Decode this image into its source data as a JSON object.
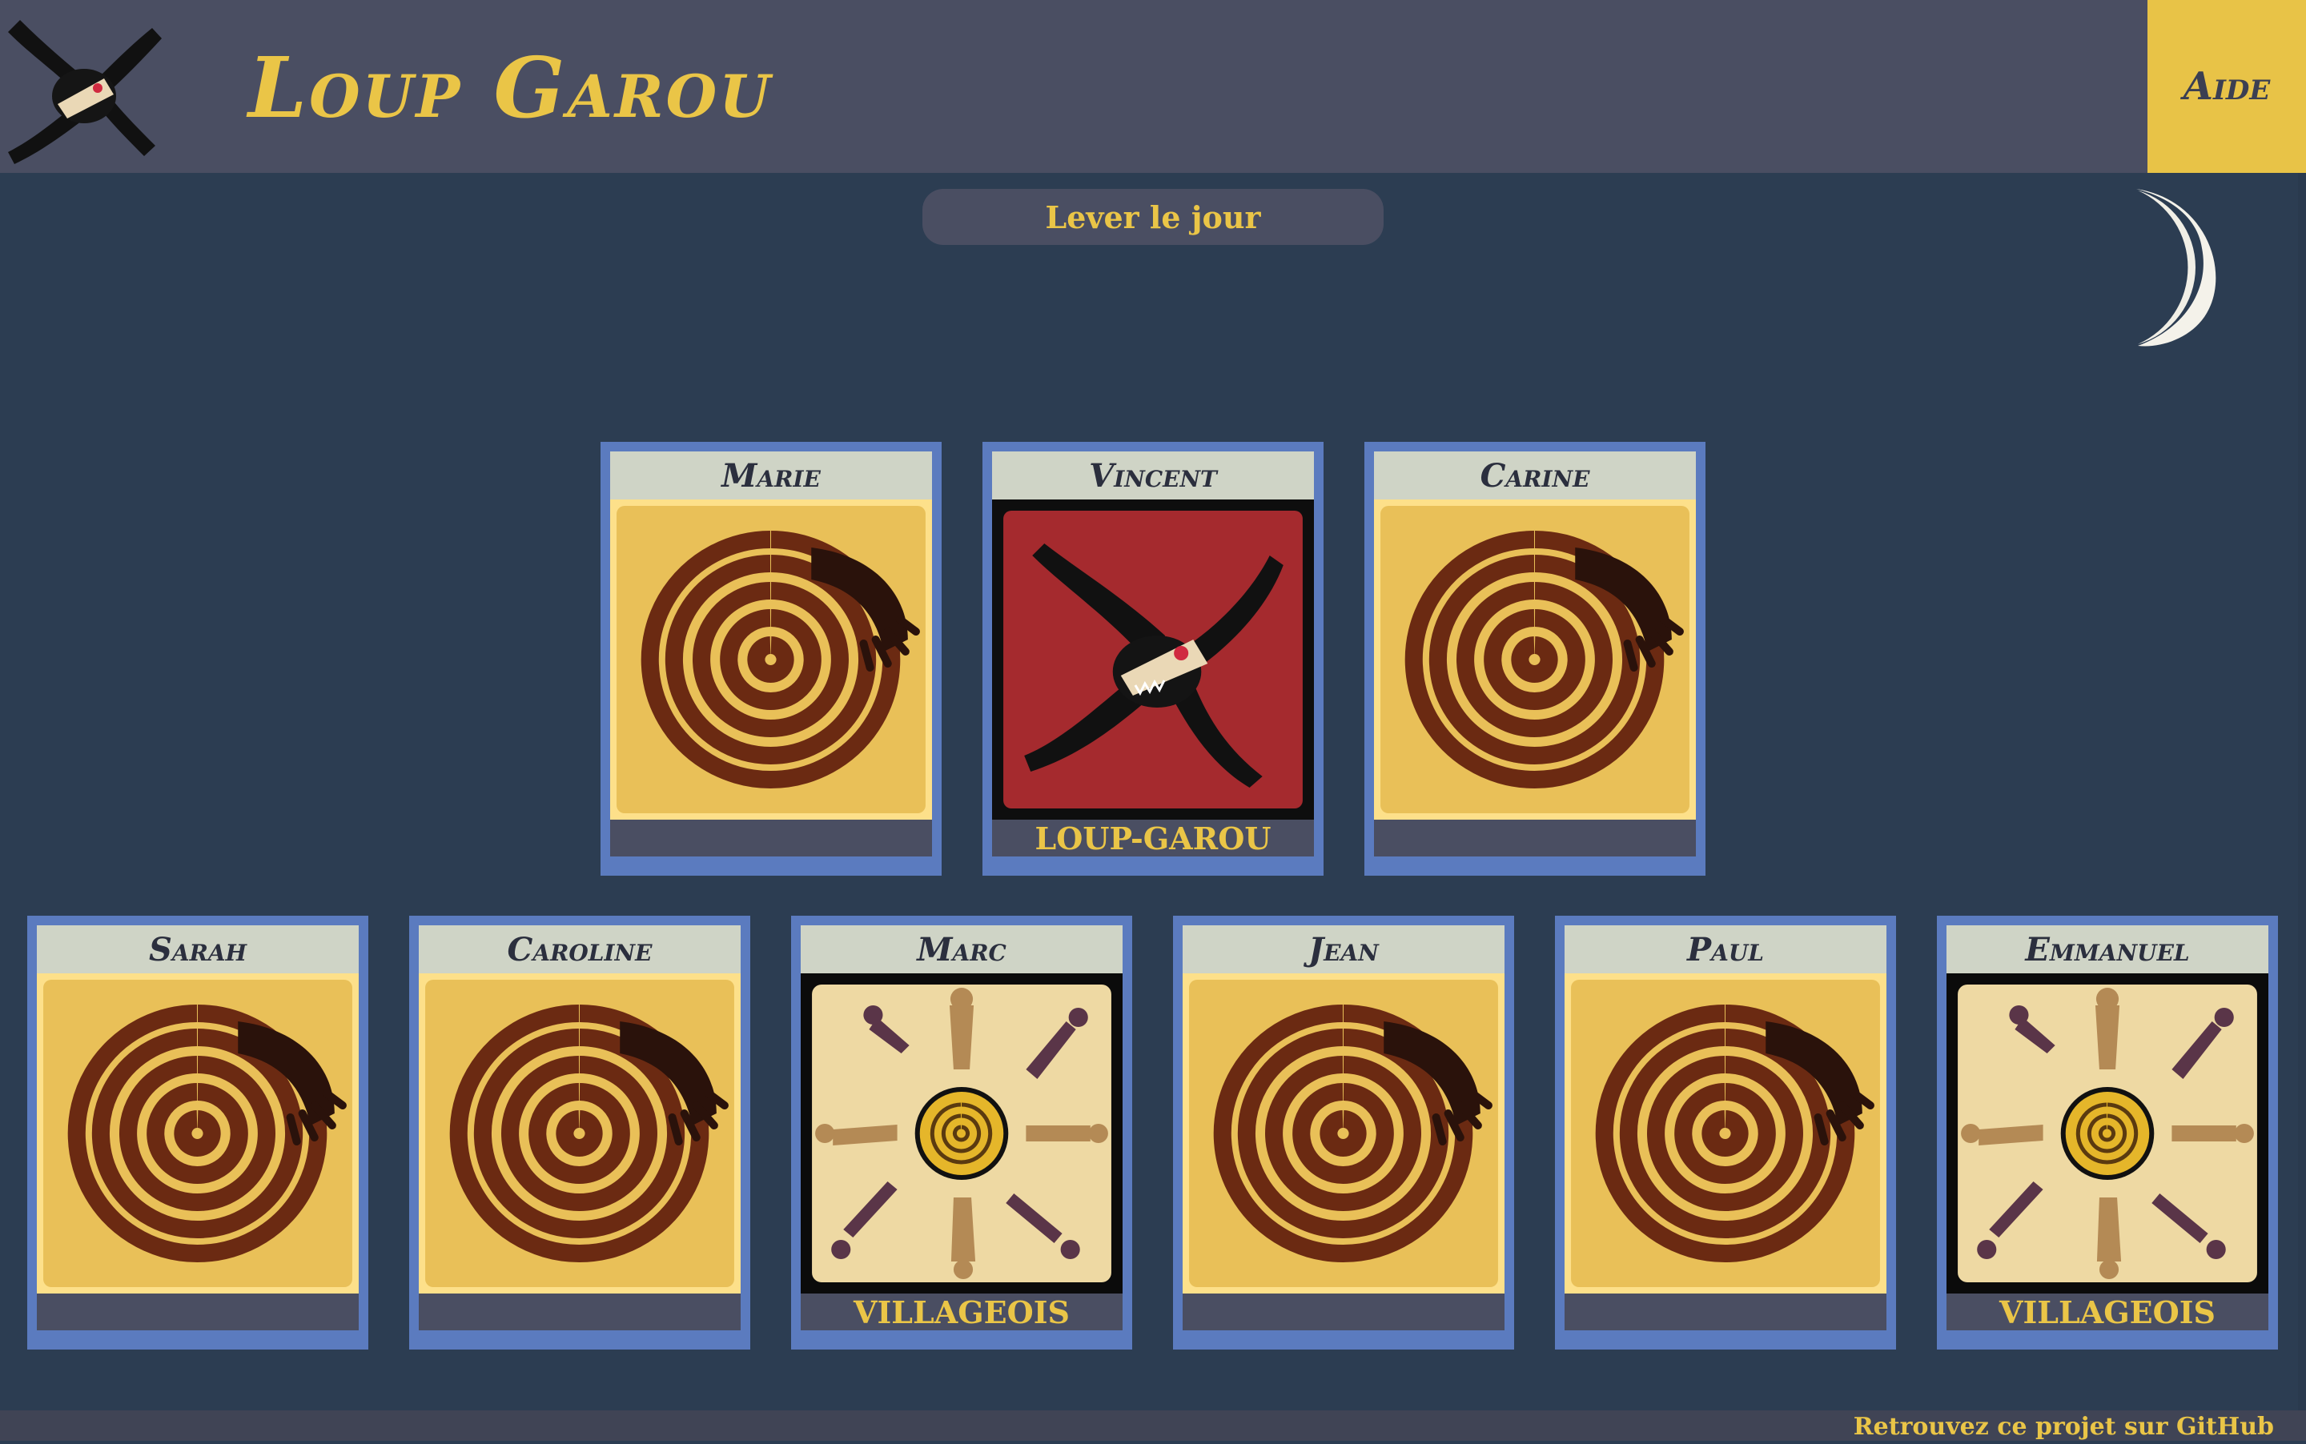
{
  "app": {
    "title": "Loup Garou",
    "help_label": "Aide"
  },
  "actions": {
    "day_button": "Lever le jour"
  },
  "footer": {
    "link": "Retrouvez ce projet sur GitHub"
  },
  "colors": {
    "accent": "#eac547",
    "header_bg": "#4a4e62",
    "page_bg": "#2c3d52",
    "card_border": "#5b7bbf"
  },
  "night_icon": "moon-icon",
  "players": [
    {
      "name": "Marie",
      "role": "",
      "card": "hidden"
    },
    {
      "name": "Vincent",
      "role": "LOUP-GAROU",
      "card": "werewolf"
    },
    {
      "name": "Carine",
      "role": "",
      "card": "hidden"
    },
    {
      "name": "Sarah",
      "role": "",
      "card": "hidden"
    },
    {
      "name": "Caroline",
      "role": "",
      "card": "hidden"
    },
    {
      "name": "Marc",
      "role": "VILLAGEOIS",
      "card": "villager"
    },
    {
      "name": "Jean",
      "role": "",
      "card": "hidden"
    },
    {
      "name": "Paul",
      "role": "",
      "card": "hidden"
    },
    {
      "name": "Emmanuel",
      "role": "VILLAGEOIS",
      "card": "villager"
    }
  ]
}
